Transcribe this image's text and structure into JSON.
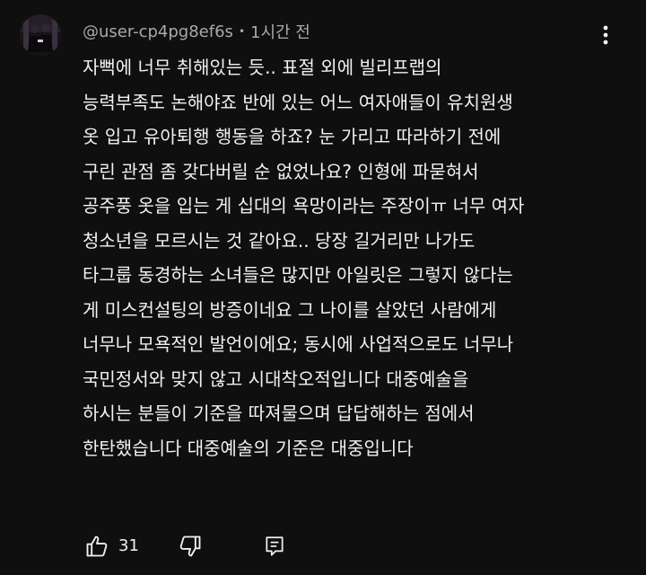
{
  "comment": {
    "author": "@user-cp4pg8ef6s",
    "separator": "•",
    "time": "1시간 전",
    "lines": [
      "자뻑에 너무 취해있는 듯.. 표절 외에 빌리프랩의",
      "능력부족도 논해야죠 반에 있는 어느 여자애들이 유치원생",
      "옷 입고 유아퇴행 행동을 하죠? 눈 가리고 따라하기 전에",
      "구린 관점 좀 갖다버릴 순 없었나요? 인형에 파묻혀서",
      "공주풍 옷을 입는 게 십대의 욕망이라는 주장이ㅠ 너무 여자",
      "청소년을 모르시는 것 같아요.. 당장 길거리만 나가도",
      "타그룹 동경하는 소녀들은 많지만 아일릿은 그렇지 않다는",
      "게 미스컨설팅의 방증이네요 그 나이를 살았던 사람에게",
      "너무나 모욕적인 발언이에요; 동시에 사업적으로도 너무나",
      "국민정서와 맞지 않고 시대착오적입니다 대중예술을",
      "하시는 분들이 기준을 따져물으며 답답해하는 점에서",
      "한탄했습니다 대중예술의 기준은 대중입니다"
    ],
    "like_count": "31"
  },
  "icons": {
    "menu": "more-vertical-icon",
    "like": "thumbs-up-icon",
    "dislike": "thumbs-down-icon",
    "reply": "reply-comment-icon"
  },
  "colors": {
    "background": "#0f0f0f",
    "text": "#f1f1f1",
    "secondary_text": "#aaaaaa"
  }
}
